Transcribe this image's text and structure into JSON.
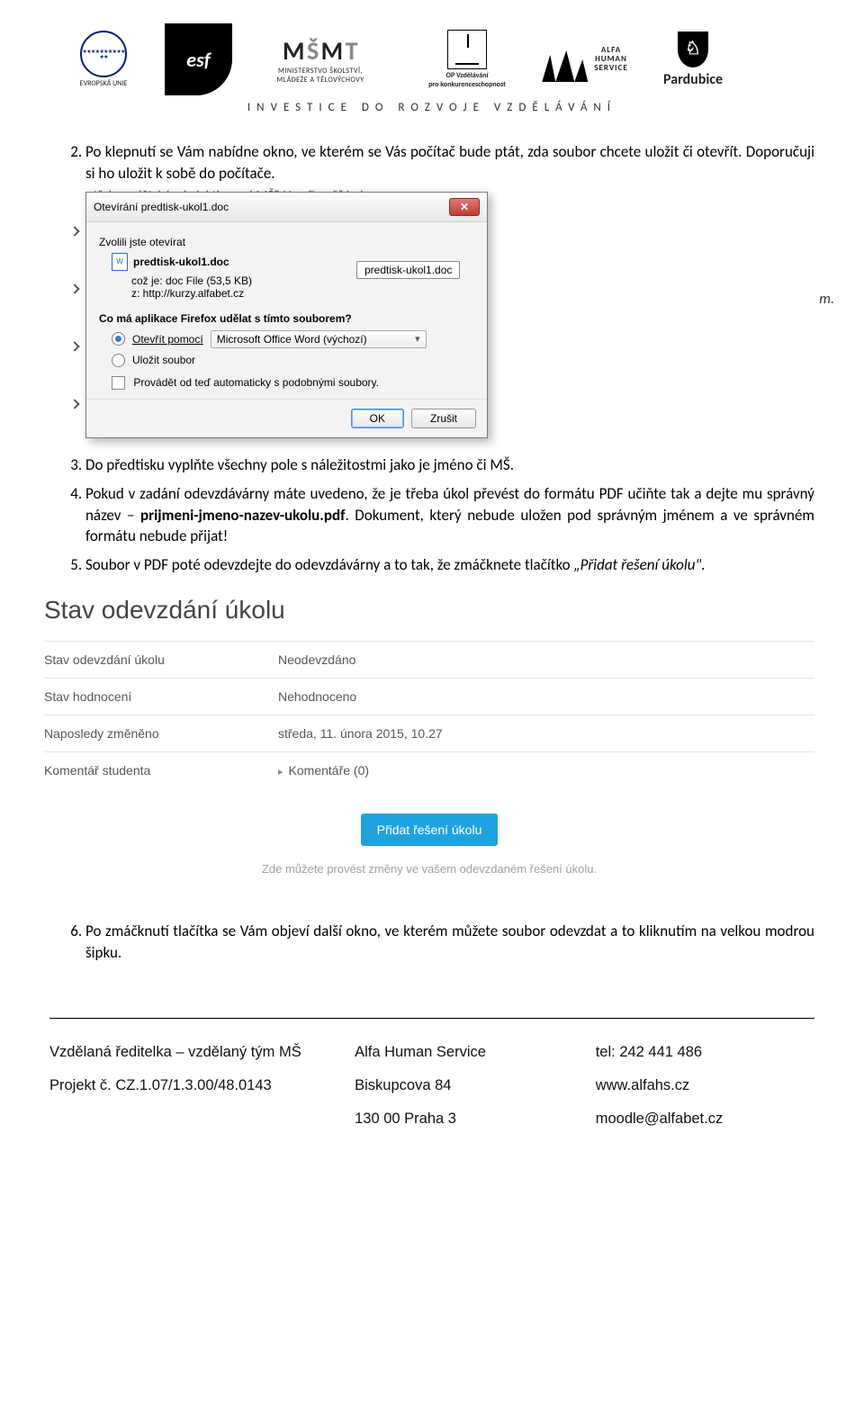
{
  "header": {
    "invest_line": "INVESTICE DO ROZVOJE VZDĚLÁVÁNÍ",
    "logos": {
      "eu": "EVROPSKÁ UNIE",
      "esf": "esf",
      "msmt_top": "MŠMT",
      "msmt_line1": "MINISTERSTVO ŠKOLSTVÍ,",
      "msmt_line2": "MLÁDEŽE A TĚLOVÝCHOVY",
      "op_line1": "OP Vzdělávání",
      "op_line2": "pro konkurenceschopnost",
      "ahs_line1": "ALFA",
      "ahs_line2": "HUMAN",
      "ahs_line3": "SERVICE",
      "pardubice": "Pardubice"
    }
  },
  "list": {
    "item2": "Po klepnutí se Vám nabídne okno, ve kterém se Vás počítač bude ptát, zda soubor chcete uložit či otevřít. Doporučuji si ho uložit k sobě do počítače.",
    "item3": "Do předtisku vyplňte všechny pole s náležitostmi jako je jméno či MŠ.",
    "item4_a": "Pokud v zadání odevzdávárny máte uvedeno, že je třeba úkol převést do formátu PDF učiňte tak a dejte mu správný název – ",
    "item4_b": "prijmeni-jmeno-nazev-ukolu.pdf",
    "item4_c": ". Dokument, který nebude uložen pod správným jménem a ve správném formátu nebude přijat!",
    "item5_a": "Soubor v PDF poté odevzdejte do odevzdávárny a to tak, že zmáčknete tlačítko ",
    "item5_b": "„Přidat řešení úkolu\".",
    "item6": "Po zmáčknutí tlačítka se Vám objeví další okno, ve kterém můžete soubor odevzdat a to kliknutím na velkou modrou šipku."
  },
  "dialog": {
    "bg_text": "otřebu v dětském kolektivu své MŠ? Uveďte příklad",
    "right_frag": "m.",
    "title": "Otevírání predtisk-ukol1.doc",
    "chose": "Zvolili jste otevírat",
    "filename": "predtisk-ukol1.doc",
    "filetype": "což je: doc File (53,5 KB)",
    "source": "z: http://kurzy.alfabet.cz",
    "label_box": "predtisk-ukol1.doc",
    "question": "Co má aplikace Firefox udělat s tímto souborem?",
    "open_with": "Otevřít pomocí",
    "open_app": "Microsoft Office Word (výchozí)",
    "save": "Uložit soubor",
    "auto": "Provádět od teď automaticky s podobnými soubory.",
    "ok": "OK",
    "cancel": "Zrušit"
  },
  "moodle": {
    "heading": "Stav odevzdání úkolu",
    "rows": [
      {
        "label": "Stav odevzdání úkolu",
        "value": "Neodevzdáno"
      },
      {
        "label": "Stav hodnocení",
        "value": "Nehodnoceno"
      },
      {
        "label": "Naposledy změněno",
        "value": "středa, 11. února 2015, 10.27"
      },
      {
        "label": "Komentář studenta",
        "value": "Komentáře (0)"
      }
    ],
    "button": "Přidat řešení úkolu",
    "hint": "Zde můžete provést změny ve vašem odevzdaném řešení úkolu."
  },
  "footer": {
    "r1c1": "Vzdělaná ředitelka – vzdělaný tým MŠ",
    "r1c2": "Alfa Human Service",
    "r1c3": "tel: 242 441 486",
    "r2c1": "Projekt č. CZ.1.07/1.3.00/48.0143",
    "r2c2": "Biskupcova 84",
    "r2c3": "www.alfahs.cz",
    "r3c1": "",
    "r3c2": "130 00 Praha 3",
    "r3c3": "moodle@alfabet.cz"
  }
}
